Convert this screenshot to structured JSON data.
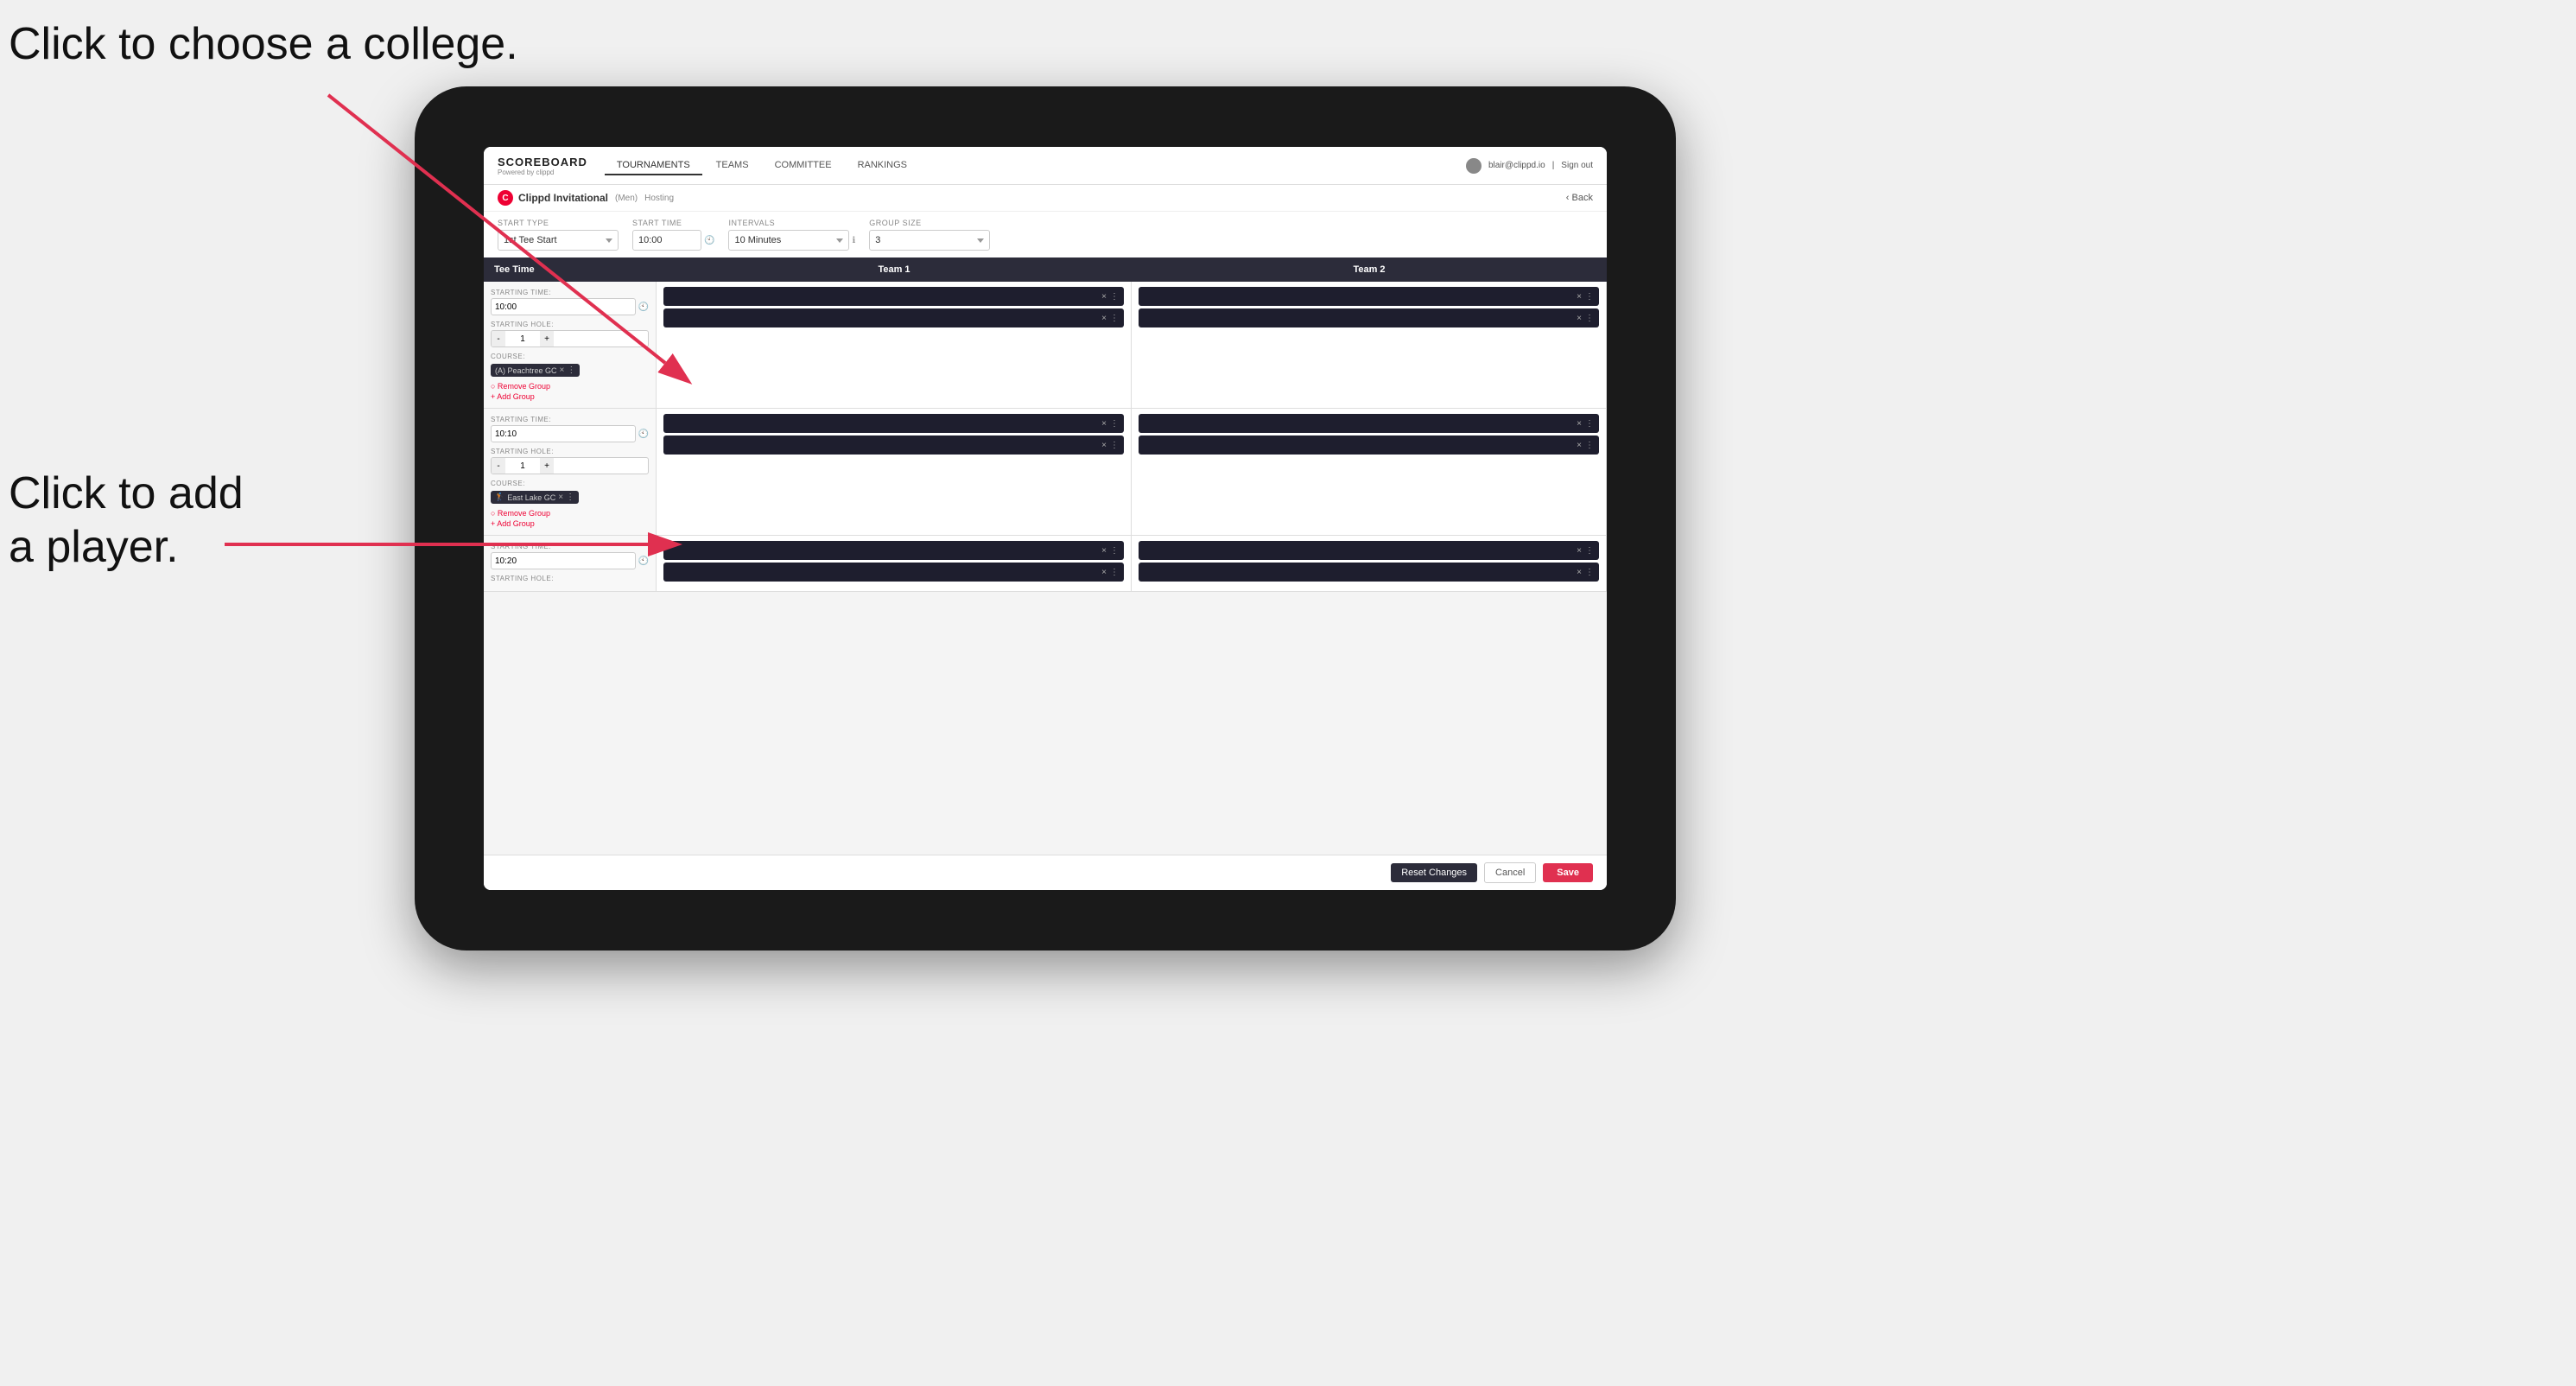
{
  "annotations": {
    "text1": "Click to choose a college.",
    "text2": "Click to add\na player."
  },
  "nav": {
    "logo": "SCOREBOARD",
    "logo_sub": "Powered by clippd",
    "tabs": [
      "TOURNAMENTS",
      "TEAMS",
      "COMMITTEE",
      "RANKINGS"
    ],
    "user_email": "blair@clippd.io",
    "sign_out": "Sign out",
    "back": "Back"
  },
  "sub_header": {
    "tournament": "Clippd Invitational",
    "gender": "(Men)",
    "hosting": "Hosting"
  },
  "controls": {
    "start_type_label": "Start Type",
    "start_type_value": "1st Tee Start",
    "start_time_label": "Start Time",
    "start_time_value": "10:00",
    "intervals_label": "Intervals",
    "intervals_value": "10 Minutes",
    "group_size_label": "Group Size",
    "group_size_value": "3"
  },
  "table": {
    "col1": "Tee Time",
    "col2": "Team 1",
    "col3": "Team 2"
  },
  "groups": [
    {
      "starting_time": "10:00",
      "starting_hole": "1",
      "course": "(A) Peachtree GC",
      "players_team1": 2,
      "players_team2": 2,
      "actions": [
        "Remove Group",
        "Add Group"
      ]
    },
    {
      "starting_time": "10:10",
      "starting_hole": "1",
      "course": "East Lake GC",
      "players_team1": 2,
      "players_team2": 2,
      "actions": [
        "Remove Group",
        "Add Group"
      ]
    },
    {
      "starting_time": "10:20",
      "starting_hole": "",
      "course": "",
      "players_team1": 2,
      "players_team2": 2,
      "actions": []
    }
  ],
  "footer": {
    "reset": "Reset Changes",
    "cancel": "Cancel",
    "save": "Save"
  }
}
